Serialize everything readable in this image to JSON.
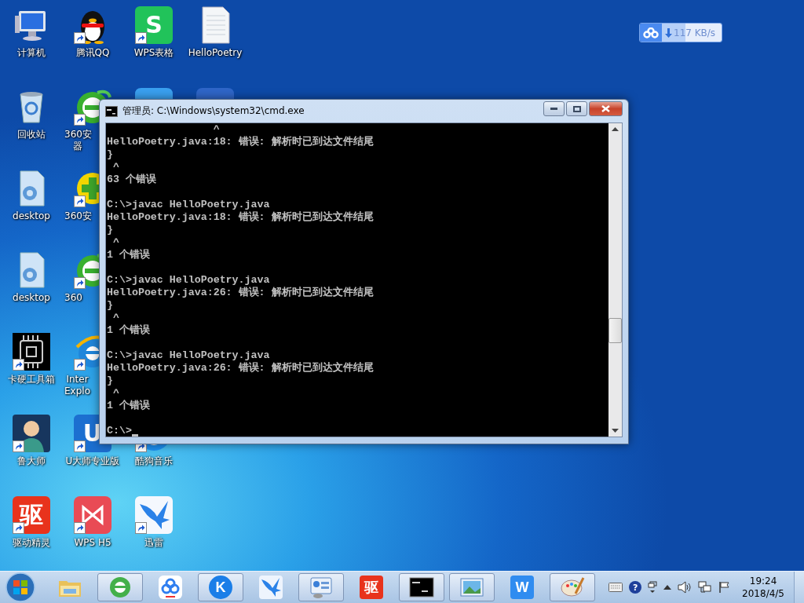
{
  "desktop": {
    "columns": [
      [
        {
          "kind": "computer",
          "label": "计算机",
          "shortcut": false
        },
        {
          "kind": "recycle",
          "label": "回收站",
          "shortcut": false
        },
        {
          "kind": "gear-doc",
          "label": "desktop",
          "shortcut": false
        },
        {
          "kind": "gear-doc",
          "label": "desktop",
          "shortcut": false
        },
        {
          "kind": "chip",
          "label": "卡硬工具箱",
          "shortcut": true
        },
        {
          "kind": "figure",
          "label": "鲁大师",
          "shortcut": true
        },
        {
          "kind": "tile",
          "glyph": "驱",
          "color": "#e8331c",
          "label": "驱动精灵",
          "shortcut": true
        }
      ],
      [
        {
          "kind": "qq",
          "label": "腾讯QQ",
          "shortcut": true
        },
        {
          "kind": "ball",
          "label_lines": [
            "360安",
            "器"
          ],
          "shortcut": true
        },
        {
          "kind": "plus",
          "label": "360安",
          "shortcut": true
        },
        {
          "kind": "ball",
          "label": "360",
          "shortcut": true
        },
        {
          "kind": "ie",
          "label_lines": [
            "Inter",
            "Explo"
          ],
          "shortcut": true
        },
        {
          "kind": "tile",
          "glyph": "U",
          "color": "#1c6fd0",
          "label": "U大师专业版",
          "shortcut": true
        },
        {
          "kind": "bowtie",
          "color": "#e94b55",
          "label": "WPS H5",
          "shortcut": true
        }
      ],
      [
        {
          "kind": "tile",
          "glyph": "S",
          "color": "#21c35a",
          "label": "WPS表格",
          "shortcut": true
        },
        {
          "kind": "partial",
          "color": "#3aa0f0"
        },
        {
          "kind": "covered"
        },
        {
          "kind": "covered"
        },
        {
          "kind": "covered"
        },
        {
          "kind": "kugou",
          "label": "酷狗音乐",
          "shortcut": true
        },
        {
          "kind": "bird",
          "label": "迅雷",
          "shortcut": true
        }
      ],
      [
        {
          "kind": "document",
          "label": "HelloPoetry",
          "shortcut": false
        },
        {
          "kind": "partial",
          "color": "#2f66c8"
        }
      ]
    ]
  },
  "speed_widget": {
    "reading": "117 KB/s"
  },
  "window": {
    "title": "管理员: C:\\Windows\\system32\\cmd.exe",
    "console_blocks": [
      [
        "                 ^",
        "HelloPoetry.java:18: 错误: 解析时已到达文件结尾",
        "}",
        " ^",
        "63 个错误"
      ],
      [
        "C:\\>javac HelloPoetry.java",
        "HelloPoetry.java:18: 错误: 解析时已到达文件结尾",
        "}",
        " ^",
        "1 个错误"
      ],
      [
        "C:\\>javac HelloPoetry.java",
        "HelloPoetry.java:26: 错误: 解析时已到达文件结尾",
        "}",
        " ^",
        "1 个错误"
      ],
      [
        "C:\\>javac HelloPoetry.java",
        "HelloPoetry.java:26: 错误: 解析时已到达文件结尾",
        "}",
        " ^",
        "1 个错误"
      ],
      [
        "C:\\>"
      ]
    ]
  },
  "taskbar": {
    "items": [
      {
        "kind": "folder",
        "running": false
      },
      {
        "kind": "ie",
        "running": true
      },
      {
        "kind": "cloud",
        "running": false
      },
      {
        "kind": "round",
        "glyph": "K",
        "color": "#1a7ee8",
        "running": true
      },
      {
        "kind": "bird",
        "running": false
      },
      {
        "kind": "panel",
        "running": true
      },
      {
        "kind": "tile",
        "glyph": "驱",
        "color": "#e8331c",
        "running": false
      },
      {
        "kind": "cmd",
        "running": true
      },
      {
        "kind": "photo",
        "running": true
      },
      {
        "kind": "tile",
        "glyph": "W",
        "color": "#2f8cf0",
        "running": false
      },
      {
        "kind": "paint",
        "running": true
      }
    ],
    "tray": {
      "help_glyph": "?",
      "time": "19:24",
      "date": "2018/4/5"
    }
  }
}
